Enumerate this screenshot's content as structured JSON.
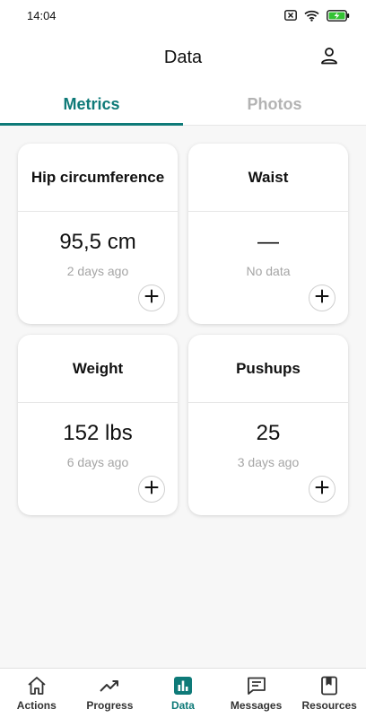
{
  "status_bar": {
    "time": "14:04",
    "icons": [
      "close-box-icon",
      "wifi-icon",
      "battery-charging-icon"
    ]
  },
  "header": {
    "title": "Data",
    "profile_icon": "user-icon"
  },
  "tabs": [
    {
      "label": "Metrics",
      "active": true
    },
    {
      "label": "Photos",
      "active": false
    }
  ],
  "metrics": [
    {
      "title": "Hip circumference",
      "value": "95,5 cm",
      "sub": "2 days ago"
    },
    {
      "title": "Waist",
      "value": "—",
      "sub": "No data"
    },
    {
      "title": "Weight",
      "value": "152 lbs",
      "sub": "6 days ago"
    },
    {
      "title": "Pushups",
      "value": "25",
      "sub": "3 days ago"
    }
  ],
  "bottom_nav": [
    {
      "label": "Actions",
      "icon": "home-icon",
      "active": false
    },
    {
      "label": "Progress",
      "icon": "trending-up-icon",
      "active": false
    },
    {
      "label": "Data",
      "icon": "bar-chart-icon",
      "active": true
    },
    {
      "label": "Messages",
      "icon": "message-icon",
      "active": false
    },
    {
      "label": "Resources",
      "icon": "book-icon",
      "active": false
    }
  ],
  "colors": {
    "accent": "#0e7a78",
    "inactive_tab": "#b3b3b3",
    "background": "#f7f7f7"
  }
}
